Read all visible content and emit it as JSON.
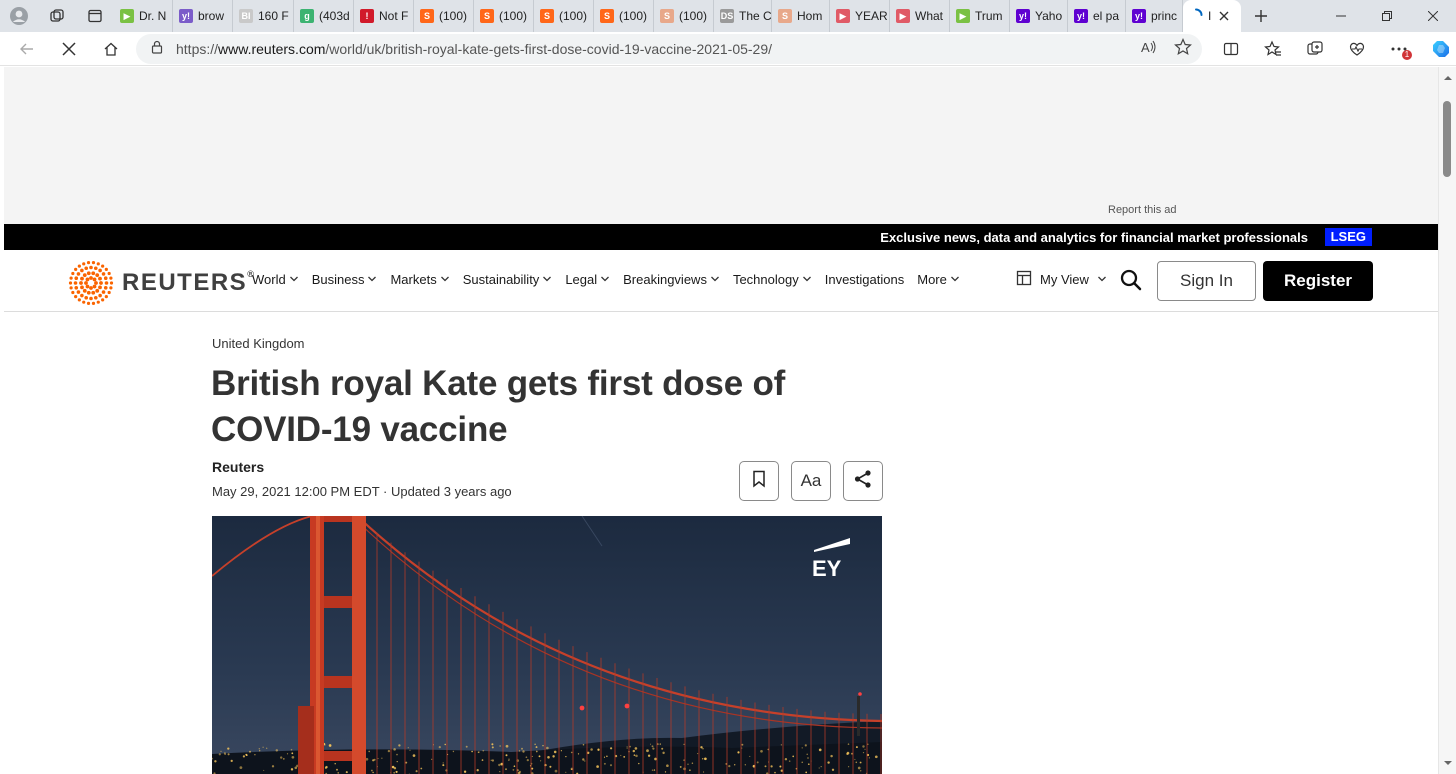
{
  "browser": {
    "tabs": [
      {
        "label": "Dr. N",
        "fav_color": "#7ac143",
        "fav_glyph": "▶"
      },
      {
        "label": "brow",
        "fav_color": "#7b5cc9",
        "fav_glyph": "y!"
      },
      {
        "label": "160 F",
        "fav_color": "#c9c9c9",
        "fav_glyph": "BI"
      },
      {
        "label": "(403d",
        "fav_color": "#3cb371",
        "fav_glyph": "g"
      },
      {
        "label": "Not F",
        "fav_color": "#d11a2a",
        "fav_glyph": "!"
      },
      {
        "label": "(100)",
        "fav_color": "#ff6719",
        "fav_glyph": "S"
      },
      {
        "label": "(100)",
        "fav_color": "#ff6719",
        "fav_glyph": "S"
      },
      {
        "label": "(100)",
        "fav_color": "#ff6719",
        "fav_glyph": "S"
      },
      {
        "label": "(100)",
        "fav_color": "#ff6719",
        "fav_glyph": "S"
      },
      {
        "label": "(100)",
        "fav_color": "#e8a88a",
        "fav_glyph": "S"
      },
      {
        "label": "The C",
        "fav_color": "#9a9a9a",
        "fav_glyph": "DS"
      },
      {
        "label": "Hom",
        "fav_color": "#e8a88a",
        "fav_glyph": "S"
      },
      {
        "label": "YEAR",
        "fav_color": "#e05a66",
        "fav_glyph": "▶"
      },
      {
        "label": "What",
        "fav_color": "#e05a66",
        "fav_glyph": "▶"
      },
      {
        "label": "Trum",
        "fav_color": "#7ac143",
        "fav_glyph": "▶"
      },
      {
        "label": "Yaho",
        "fav_color": "#5f01d1",
        "fav_glyph": "y!"
      },
      {
        "label": "el pa",
        "fav_color": "#5f01d1",
        "fav_glyph": "y!"
      },
      {
        "label": "princ",
        "fav_color": "#5f01d1",
        "fav_glyph": "y!"
      }
    ],
    "active_tab_label": "I",
    "url_scheme": "https://",
    "url_host": "www.reuters.com",
    "url_path": "/world/uk/british-royal-kate-gets-first-dose-covid-19-vaccine-2021-05-29/",
    "profile_badge_count": "1"
  },
  "ad": {
    "report_label": "Report this ad"
  },
  "promo": {
    "text": "Exclusive news, data and analytics for financial market professionals",
    "badge": "LSEG"
  },
  "nav": {
    "logo_text": "REUTERS",
    "logo_mark": "®",
    "brand_color": "#fa6400",
    "items": [
      {
        "label": "World",
        "has_menu": true
      },
      {
        "label": "Business",
        "has_menu": true
      },
      {
        "label": "Markets",
        "has_menu": true
      },
      {
        "label": "Sustainability",
        "has_menu": true
      },
      {
        "label": "Legal",
        "has_menu": true
      },
      {
        "label": "Breakingviews",
        "has_menu": true
      },
      {
        "label": "Technology",
        "has_menu": true
      },
      {
        "label": "Investigations",
        "has_menu": false
      },
      {
        "label": "More",
        "has_menu": true
      }
    ],
    "myview_label": "My View",
    "signin_label": "Sign In",
    "register_label": "Register"
  },
  "article": {
    "kicker": "United Kingdom",
    "headline": "British royal Kate gets first dose of COVID-19 vaccine",
    "byline": "Reuters",
    "dateline": "May 29, 2021 12:00 PM EDT · Updated 3 years ago",
    "text_size_label": "Aa",
    "hero_logo_text": "EY"
  }
}
